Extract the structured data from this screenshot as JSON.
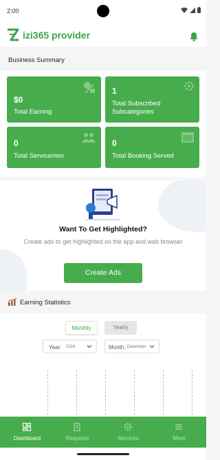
{
  "status_bar": {
    "time": "2:00"
  },
  "app_bar": {
    "title": "izi365 provider"
  },
  "business_summary": {
    "heading": "Business Summary",
    "cards": [
      {
        "value": "$0",
        "label": "Total Earning",
        "icon": "money-icon"
      },
      {
        "value": "1",
        "label": "Total Subscribed Subcategories",
        "icon": "settings-icon"
      },
      {
        "value": "0",
        "label": "Total Servicemen",
        "icon": "group-icon"
      },
      {
        "value": "0",
        "label": "Total Booking Served",
        "icon": "calendar-icon"
      }
    ]
  },
  "promo": {
    "heading": "Want To Get Highlighted?",
    "description": "Create ads to get highlighted on the app and web browser",
    "button": "Create Ads"
  },
  "earning_statistics": {
    "heading": "Earning Statistics",
    "tabs": [
      "Monthly",
      "Yearly"
    ],
    "active_tab": "Monthly",
    "year": {
      "label": "Year:",
      "value": "2024"
    },
    "month": {
      "label": "Month:",
      "value": "December"
    }
  },
  "bottom_nav": [
    {
      "label": "Dashboard",
      "icon": "dashboard-icon",
      "active": true
    },
    {
      "label": "Requests",
      "icon": "requests-icon",
      "active": false
    },
    {
      "label": "Services",
      "icon": "services-icon",
      "active": false
    },
    {
      "label": "More",
      "icon": "menu-icon",
      "active": false
    }
  ],
  "colors": {
    "primary": "#47ad4c",
    "brand_text": "#3aa447",
    "background": "#f5f5f5"
  }
}
